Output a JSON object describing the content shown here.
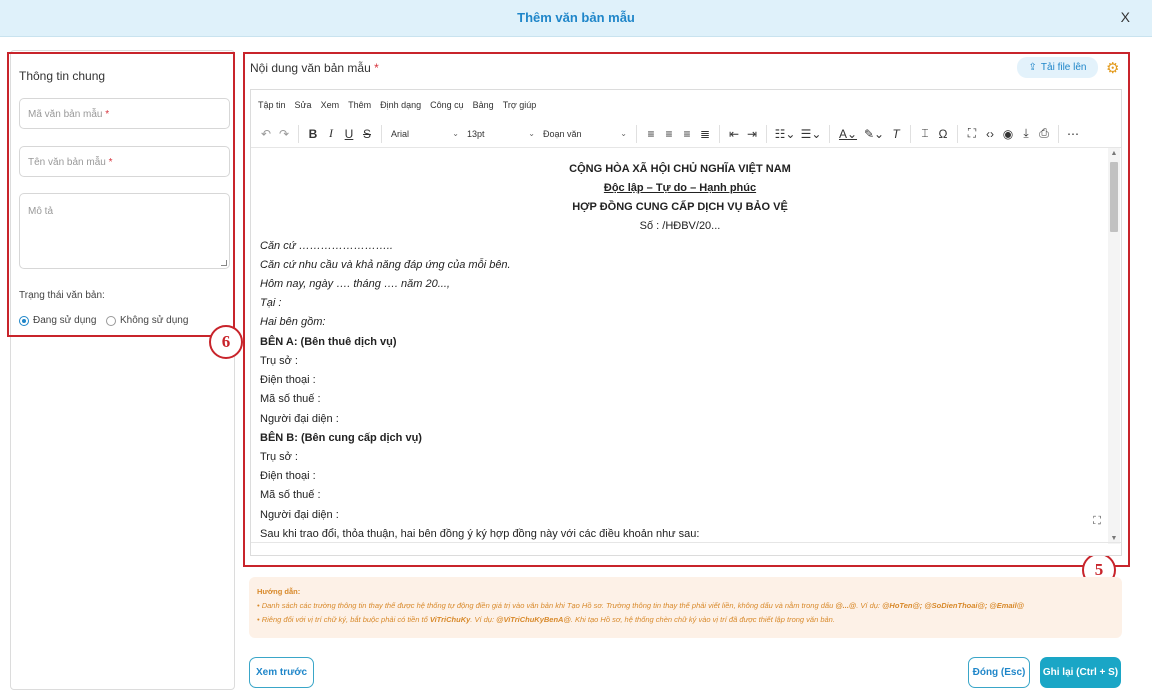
{
  "modal": {
    "title": "Thêm văn bản mẫu",
    "close": "X"
  },
  "left": {
    "section_title": "Thông tin chung",
    "code_placeholder": "Mã văn bản mẫu",
    "name_placeholder": "Tên văn bản mẫu",
    "required_mark": "*",
    "desc_placeholder": "Mô tả",
    "status_label": "Trạng thái văn bản:",
    "status_options": [
      "Đang sử dụng",
      "Không sử dụng"
    ],
    "status_selected": "Đang sử dụng"
  },
  "badges": {
    "left": "6",
    "editor": "5"
  },
  "editor": {
    "label": "Nội dung văn bản mẫu",
    "upload_label": "Tải file lên",
    "menu": [
      "Tập tin",
      "Sửa",
      "Xem",
      "Thêm",
      "Định dạng",
      "Công cụ",
      "Bảng",
      "Trợ giúp"
    ],
    "font": "Arial",
    "size": "13pt",
    "block": "Đoạn văn",
    "doc": {
      "h1": "CỘNG HÒA XÃ HỘI CHỦ NGHĨA VIỆT NAM",
      "h2": "Độc lập – Tự do – Hạnh phúc",
      "h3": "HỢP ĐỒNG CUNG CẤP DỊCH VỤ BẢO VỆ",
      "no": "Số : /HĐBV/20...",
      "l1": "Căn cứ ……………………..",
      "l2": "Căn cứ nhu cầu và khả năng đáp ứng của mỗi bên.",
      "l3": "Hôm nay, ngày …. tháng …. năm 20...,",
      "l4": " Tại :",
      "l5": "Hai bên gồm:",
      "a_title": "BÊN A: (Bên thuê dịch vụ)",
      "a1": "Trụ sở :",
      "a2": " Điện thoại :",
      "a3": " Mã số thuế :",
      "a4": " Người đại diện :",
      "b_title": "BÊN B: (Bên cung cấp dịch vụ)",
      "b1": " Trụ sở :",
      "b2": " Điện thoại :",
      "b3": " Mã số thuế :",
      "b4": " Người đại diện :",
      "last": "Sau khi trao đổi, thỏa thuận, hai bên đồng ý ký hợp đồng này với các điều khoản như sau:"
    }
  },
  "guide": {
    "title": "Hướng dẫn:",
    "line1_text": "Danh sách các trường thông tin thay thế được hệ thống tự động điền giá trị vào văn bản khi Tạo Hồ sơ. Trường thông tin thay thế phải viết liền, không dấu và nằm trong dấu",
    "line1_code": "@...@",
    "line1_ex": ". Ví dụ:",
    "line1_vars": "@HoTen@; @SoDienThoai@; @Email@",
    "line2_text": "Riêng đối với vị trí chữ ký, bắt buộc phải có tiền tố",
    "line2_prefix": "ViTriChuKy",
    "line2_ex": ". Ví dụ:",
    "line2_var": "@ViTriChuKyBenA@",
    "line2_rest": ". Khi tạo Hồ sơ, hệ thống chèn chữ ký vào vị trí đã được thiết lập trong văn bản."
  },
  "footer": {
    "preview": "Xem trước",
    "close": "Đóng (Esc)",
    "save": "Ghi lại (Ctrl + S)"
  },
  "colors": {
    "accent": "#1f86c9",
    "highlight_red": "#c8242b",
    "guide_text": "#d8892a",
    "guide_bg": "#fdf1e7"
  }
}
